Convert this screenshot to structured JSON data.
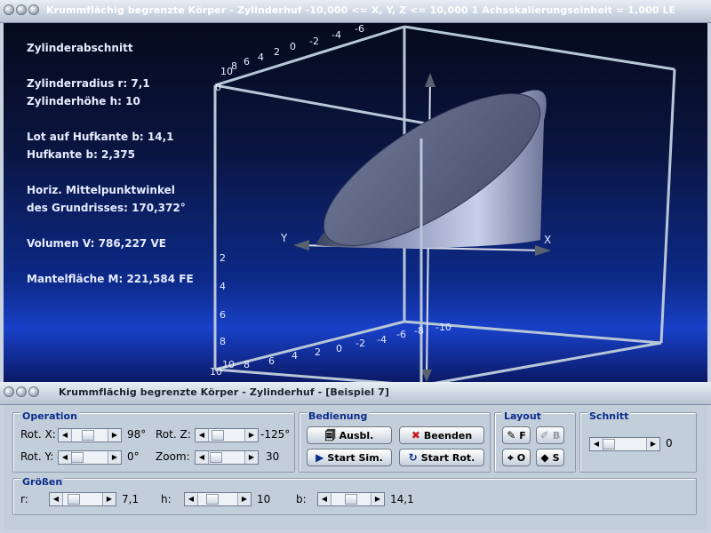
{
  "top_window": {
    "title": "Krummflächig begrenzte Körper - Zylinderhuf   -10,000 <= X, Y, Z <= 10,000    1 Achsskalierungseinheit = 1,000 LE"
  },
  "info": {
    "heading": "Zylinderabschnitt",
    "radius": "Zylinderradius r: 7,1",
    "height": "Zylinderhöhe h: 10",
    "lot": "Lot auf Hufkante b: 14,1",
    "hufkante": "Hufkante b: 2,375",
    "angle_line1": "Horiz. Mittelpunktwinkel",
    "angle_line2": "des Grundrisses: 170,372°",
    "volume": "Volumen V: 786,227 VE",
    "surface": "Mantelfläche M: 221,584 FE"
  },
  "axes": {
    "x_label": "X",
    "y_label": "Y",
    "top_ticks": [
      "10",
      "8",
      "6",
      "4",
      "2",
      "0",
      "-2",
      "-4",
      "-6"
    ],
    "bottom_ticks": [
      "10",
      "8",
      "6",
      "4",
      "2",
      "0",
      "-2",
      "-4",
      "-6",
      "-8",
      "-10"
    ],
    "left_ticks": [
      "10",
      "0",
      "2",
      "4",
      "6",
      "8",
      "10"
    ]
  },
  "bottom_window": {
    "title": "Krummflächig begrenzte Körper - Zylinderhuf - [Beispiel 7]"
  },
  "operation": {
    "title": "Operation",
    "rot_x_label": "Rot. X:",
    "rot_x_value": "98°",
    "rot_y_label": "Rot. Y:",
    "rot_y_value": "0°",
    "rot_z_label": "Rot. Z:",
    "rot_z_value": "-125°",
    "zoom_label": "Zoom:",
    "zoom_value": "30"
  },
  "bedienung": {
    "title": "Bedienung",
    "ausbl": "Ausbl.",
    "beenden": "Beenden",
    "start_sim": "Start Sim.",
    "start_rot": "Start Rot."
  },
  "layout": {
    "title": "Layout",
    "f": "F",
    "b": "B",
    "o": "O",
    "s": "S"
  },
  "schnitt": {
    "title": "Schnitt",
    "value": "0"
  },
  "groessen": {
    "title": "Größen",
    "r_label": "r:",
    "r_value": "7,1",
    "h_label": "h:",
    "h_value": "10",
    "b_label": "b:",
    "b_value": "14,1"
  },
  "colors": {
    "accent_title": "#0c2d8a",
    "beenden_icon": "#c8141c",
    "start_icon": "#0c2d8a"
  }
}
